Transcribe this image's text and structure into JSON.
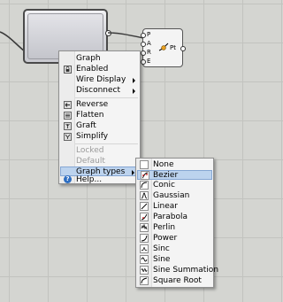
{
  "point_component": {
    "inputs": [
      "P",
      "A",
      "R",
      "E"
    ],
    "output": "Pt"
  },
  "context_menu": {
    "items": [
      {
        "label": "Graph",
        "icon": "",
        "submenu": false,
        "disabled": false
      },
      {
        "label": "Enabled",
        "icon": "enabled-icon",
        "submenu": false,
        "disabled": false
      },
      {
        "label": "Wire Display",
        "icon": "",
        "submenu": true,
        "disabled": false
      },
      {
        "label": "Disconnect",
        "icon": "",
        "submenu": true,
        "disabled": false
      },
      {
        "label": "Reverse",
        "icon": "reverse-icon",
        "submenu": false,
        "disabled": false
      },
      {
        "label": "Flatten",
        "icon": "flatten-icon",
        "submenu": false,
        "disabled": false
      },
      {
        "label": "Graft",
        "icon": "graft-icon",
        "submenu": false,
        "disabled": false
      },
      {
        "label": "Simplify",
        "icon": "simplify-icon",
        "submenu": false,
        "disabled": false
      },
      {
        "label": "Locked",
        "icon": "",
        "submenu": false,
        "disabled": true
      },
      {
        "label": "Default",
        "icon": "",
        "submenu": false,
        "disabled": true
      },
      {
        "label": "Graph types",
        "icon": "",
        "submenu": true,
        "disabled": false,
        "highlighted": true
      },
      {
        "label": "Help...",
        "icon": "help-icon",
        "submenu": false,
        "disabled": false
      }
    ]
  },
  "graph_types_menu": {
    "items": [
      {
        "label": "None",
        "icon": "none-graph-icon"
      },
      {
        "label": "Bezier",
        "icon": "bezier-graph-icon",
        "highlighted": true
      },
      {
        "label": "Conic",
        "icon": "conic-graph-icon"
      },
      {
        "label": "Gaussian",
        "icon": "gaussian-graph-icon"
      },
      {
        "label": "Linear",
        "icon": "linear-graph-icon"
      },
      {
        "label": "Parabola",
        "icon": "parabola-graph-icon"
      },
      {
        "label": "Perlin",
        "icon": "perlin-graph-icon"
      },
      {
        "label": "Power",
        "icon": "power-graph-icon"
      },
      {
        "label": "Sinc",
        "icon": "sinc-graph-icon"
      },
      {
        "label": "Sine",
        "icon": "sine-graph-icon"
      },
      {
        "label": "Sine Summation",
        "icon": "sine-summation-graph-icon"
      },
      {
        "label": "Square Root",
        "icon": "square-root-graph-icon"
      }
    ]
  },
  "colors": {
    "canvas": "#d4d5d1",
    "grid_line": "#c2c3bf",
    "menu_bg": "#f4f4f4",
    "highlight": "#bcd3ee",
    "highlight_border": "#86a7d3",
    "disabled_text": "#9b9b9b",
    "help_icon": "#2f6fc2"
  }
}
